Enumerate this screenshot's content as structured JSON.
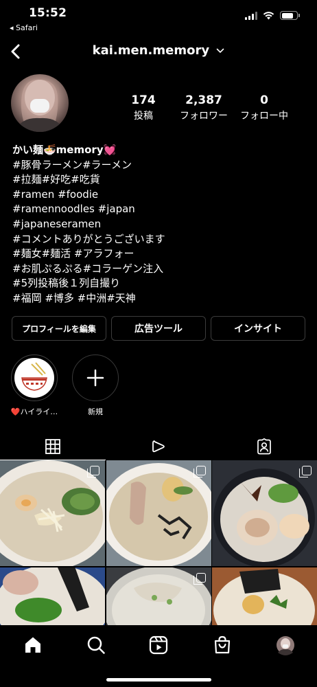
{
  "status_bar": {
    "time": "15:52",
    "back_app": "◂ Safari"
  },
  "header": {
    "username": "kai.men.memory"
  },
  "profile": {
    "stats": [
      {
        "value": "174",
        "label": "投稿"
      },
      {
        "value": "2,387",
        "label": "フォロワー"
      },
      {
        "value": "0",
        "label": "フォロー中"
      }
    ],
    "bio_name": "かい麺🍜memory💓",
    "bio_lines": [
      "#豚骨ラーメン#ラーメン",
      "#拉麺#好吃#吃貨",
      "#ramen #foodie",
      "#ramennoodles #japan",
      "#japaneseramen",
      "#コメントありがとうございます",
      "#麺女#麺活 #アラフォー",
      "#お肌ぷるぷる#コラーゲン注入",
      "#5列投稿後１列自撮り",
      "#福岡 #博多 #中洲#天神"
    ]
  },
  "buttons": {
    "edit_profile": "プロフィールを編集",
    "ad_tools": "広告ツール",
    "insights": "インサイト"
  },
  "highlights": [
    {
      "label": "❤️ハイライ…"
    },
    {
      "label": "新規"
    }
  ],
  "tabs": [
    {
      "icon": "grid-icon"
    },
    {
      "icon": "reels-icon"
    },
    {
      "icon": "tagged-icon"
    }
  ],
  "bottom_nav": [
    {
      "icon": "home-icon"
    },
    {
      "icon": "search-icon"
    },
    {
      "icon": "reels-icon"
    },
    {
      "icon": "shop-icon"
    },
    {
      "icon": "profile-avatar"
    }
  ]
}
